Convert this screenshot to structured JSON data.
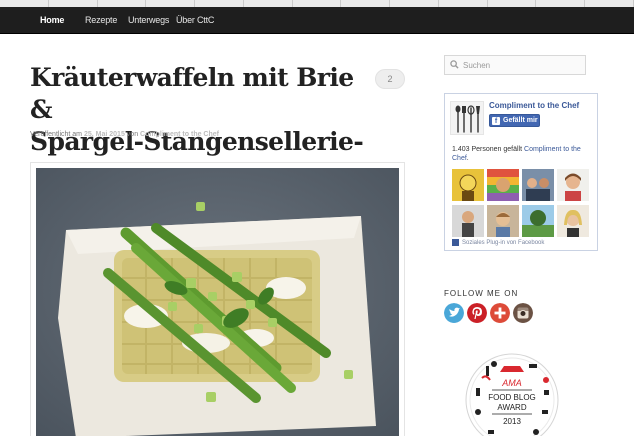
{
  "nav": {
    "items": [
      "Home",
      "Rezepte",
      "Unterwegs",
      "Über CttC"
    ],
    "active": "Home"
  },
  "post": {
    "title_line1": "Kräuterwaffeln mit Brie &",
    "title_line2": "Spargel-Stangensellerie-Salat",
    "comment_count": "2",
    "meta_prefix": "Veröffentlicht am",
    "meta_date": "25. Mai 2015",
    "meta_by": "von",
    "meta_author": "Compliment to the Chef"
  },
  "sidebar": {
    "search_placeholder": "Suchen",
    "facebook": {
      "page_name": "Compliment to the Chef",
      "like_label": "Gefällt mir",
      "count_text": "1.403 Personen gefällt",
      "count_link": "Compliment to the Chef",
      "count_suffix": ".",
      "plugin_text": "Soziales Plug-in von Facebook"
    },
    "follow_label": "FOLLOW ME ON",
    "social_icons": [
      "twitter-icon",
      "pinterest-icon",
      "google-plus-icon",
      "instagram-icon"
    ],
    "award": {
      "line1": "AMA",
      "line2": "FOOD BLOG",
      "line3": "AWARD",
      "year": "2013"
    }
  },
  "colors": {
    "nav_bg": "#1e1e1e",
    "twitter": "#4aa7d8",
    "pinterest": "#cb2027",
    "google_plus": "#dd4b39",
    "facebook": "#3b5998",
    "award_red": "#d9282f"
  }
}
